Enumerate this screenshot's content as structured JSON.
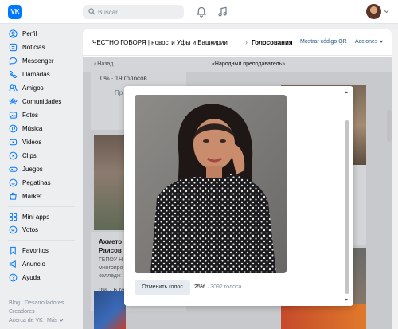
{
  "topbar": {
    "logo": "VK",
    "search_placeholder": "Buscar",
    "icons": [
      "bell-icon",
      "music-icon"
    ]
  },
  "sidebar": {
    "items": [
      {
        "label": "Perfil",
        "icon": "person-icon"
      },
      {
        "label": "Noticias",
        "icon": "news-icon"
      },
      {
        "label": "Messenger",
        "icon": "chat-icon"
      },
      {
        "label": "Llamadas",
        "icon": "phone-icon"
      },
      {
        "label": "Amigos",
        "icon": "friends-icon"
      },
      {
        "label": "Comunidades",
        "icon": "communities-icon"
      },
      {
        "label": "Fotos",
        "icon": "photo-icon"
      },
      {
        "label": "Música",
        "icon": "music-icon"
      },
      {
        "label": "Videos",
        "icon": "video-icon"
      },
      {
        "label": "Clips",
        "icon": "clips-icon"
      },
      {
        "label": "Juegos",
        "icon": "games-icon"
      },
      {
        "label": "Pegatinas",
        "icon": "stickers-icon"
      },
      {
        "label": "Market",
        "icon": "market-icon"
      }
    ],
    "items2": [
      {
        "label": "Mini apps",
        "icon": "apps-icon"
      },
      {
        "label": "Votos",
        "icon": "votes-icon"
      }
    ],
    "items3": [
      {
        "label": "Favoritos",
        "icon": "bookmark-icon"
      },
      {
        "label": "Anuncio",
        "icon": "megaphone-icon"
      },
      {
        "label": "Ayuda",
        "icon": "help-icon"
      }
    ],
    "footer": {
      "blog": "Blog",
      "developers": "Desarrolladores",
      "creators": "Creadores",
      "about": "Acerca de VK",
      "more": "Más"
    }
  },
  "header": {
    "breadcrumb": "ЧЕСТНО ГОВОРЯ | новости Уфы и Башкирии",
    "current": "Голосования",
    "qr_link": "Mostrar código QR",
    "actions": "Acciones"
  },
  "viewer": {
    "back": "Назад",
    "title": "«Народный преподаватель»"
  },
  "background_cards": {
    "top_pct": "0% · 19 голосов",
    "name_line1": "Ахмето",
    "name_line2": "Раисов",
    "org_line1": "ГБПОУ Н",
    "org_line2": "многопро",
    "org_line3": "колледж",
    "mid_pct": "0% · 6 го",
    "btn_partial": "Пр"
  },
  "modal": {
    "cancel_button": "Отменить голос",
    "percent": "25%",
    "votes": "3092 голоса"
  }
}
